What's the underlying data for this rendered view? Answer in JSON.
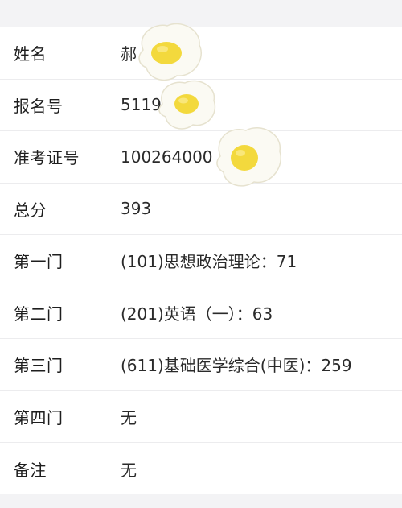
{
  "rows": [
    {
      "label": "姓名",
      "value": "郝"
    },
    {
      "label": "报名号",
      "value": "5119"
    },
    {
      "label": "准考证号",
      "value": "100264000"
    },
    {
      "label": "总分",
      "value": "393"
    },
    {
      "label": "第一门",
      "value": "(101)思想政治理论：71"
    },
    {
      "label": "第二门",
      "value": "(201)英语（一）：63"
    },
    {
      "label": "第三门",
      "value": "(611)基础医学综合(中医)：259"
    },
    {
      "label": "第四门",
      "value": "无"
    },
    {
      "label": "备注",
      "value": "无"
    }
  ],
  "stickers": {
    "name": "fried-egg-sticker",
    "color_white": "#fbfaf3",
    "color_yolk": "#f3d93d"
  }
}
